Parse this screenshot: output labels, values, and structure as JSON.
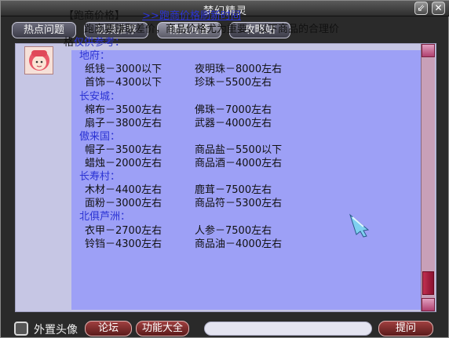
{
  "window": {
    "title": "梦幻精灵"
  },
  "tabs": [
    {
      "label": "热点问题"
    },
    {
      "label": "视频推荐"
    },
    {
      "label": "精灵问答"
    },
    {
      "label": "攻略站"
    }
  ],
  "article": {
    "heading": "【跑商价格】",
    "link": ">>跑商价格刷新时间",
    "intro1": "跑商要赚取差价，商品价格尤为重要，以下商品的合理价",
    "intro2_prefix": "格",
    "intro2_blue": "仅供参考：",
    "sections": [
      {
        "name": "地府：",
        "rows": [
          [
            "纸钱－3000以下",
            "夜明珠－8000左右"
          ],
          [
            "首饰－4300以下",
            "珍珠－5500左右"
          ]
        ]
      },
      {
        "name": "长安城：",
        "rows": [
          [
            "棉布－3500左右",
            "佛珠－7000左右"
          ],
          [
            "扇子－3800左右",
            "武器－4000左右"
          ]
        ]
      },
      {
        "name": "傲来国：",
        "rows": [
          [
            "帽子－3500左右",
            "商品盐－5500以下"
          ],
          [
            "蜡烛－2000左右",
            "商品酒－4000左右"
          ]
        ]
      },
      {
        "name": "长寿村：",
        "rows": [
          [
            "木材－4400左右",
            "鹿茸－7500左右"
          ],
          [
            "面粉－3000左右",
            "商品符－5300左右"
          ]
        ]
      },
      {
        "name": "北俱芦洲：",
        "rows": [
          [
            "衣甲－2700左右",
            "人参－7500左右"
          ],
          [
            "铃铛－4300左右",
            "商品油－4000左右"
          ]
        ]
      }
    ]
  },
  "bottom": {
    "avatar_toggle": "外置头像",
    "forum": "论坛",
    "features": "功能大全",
    "ask": "提问",
    "ask_value": ""
  }
}
